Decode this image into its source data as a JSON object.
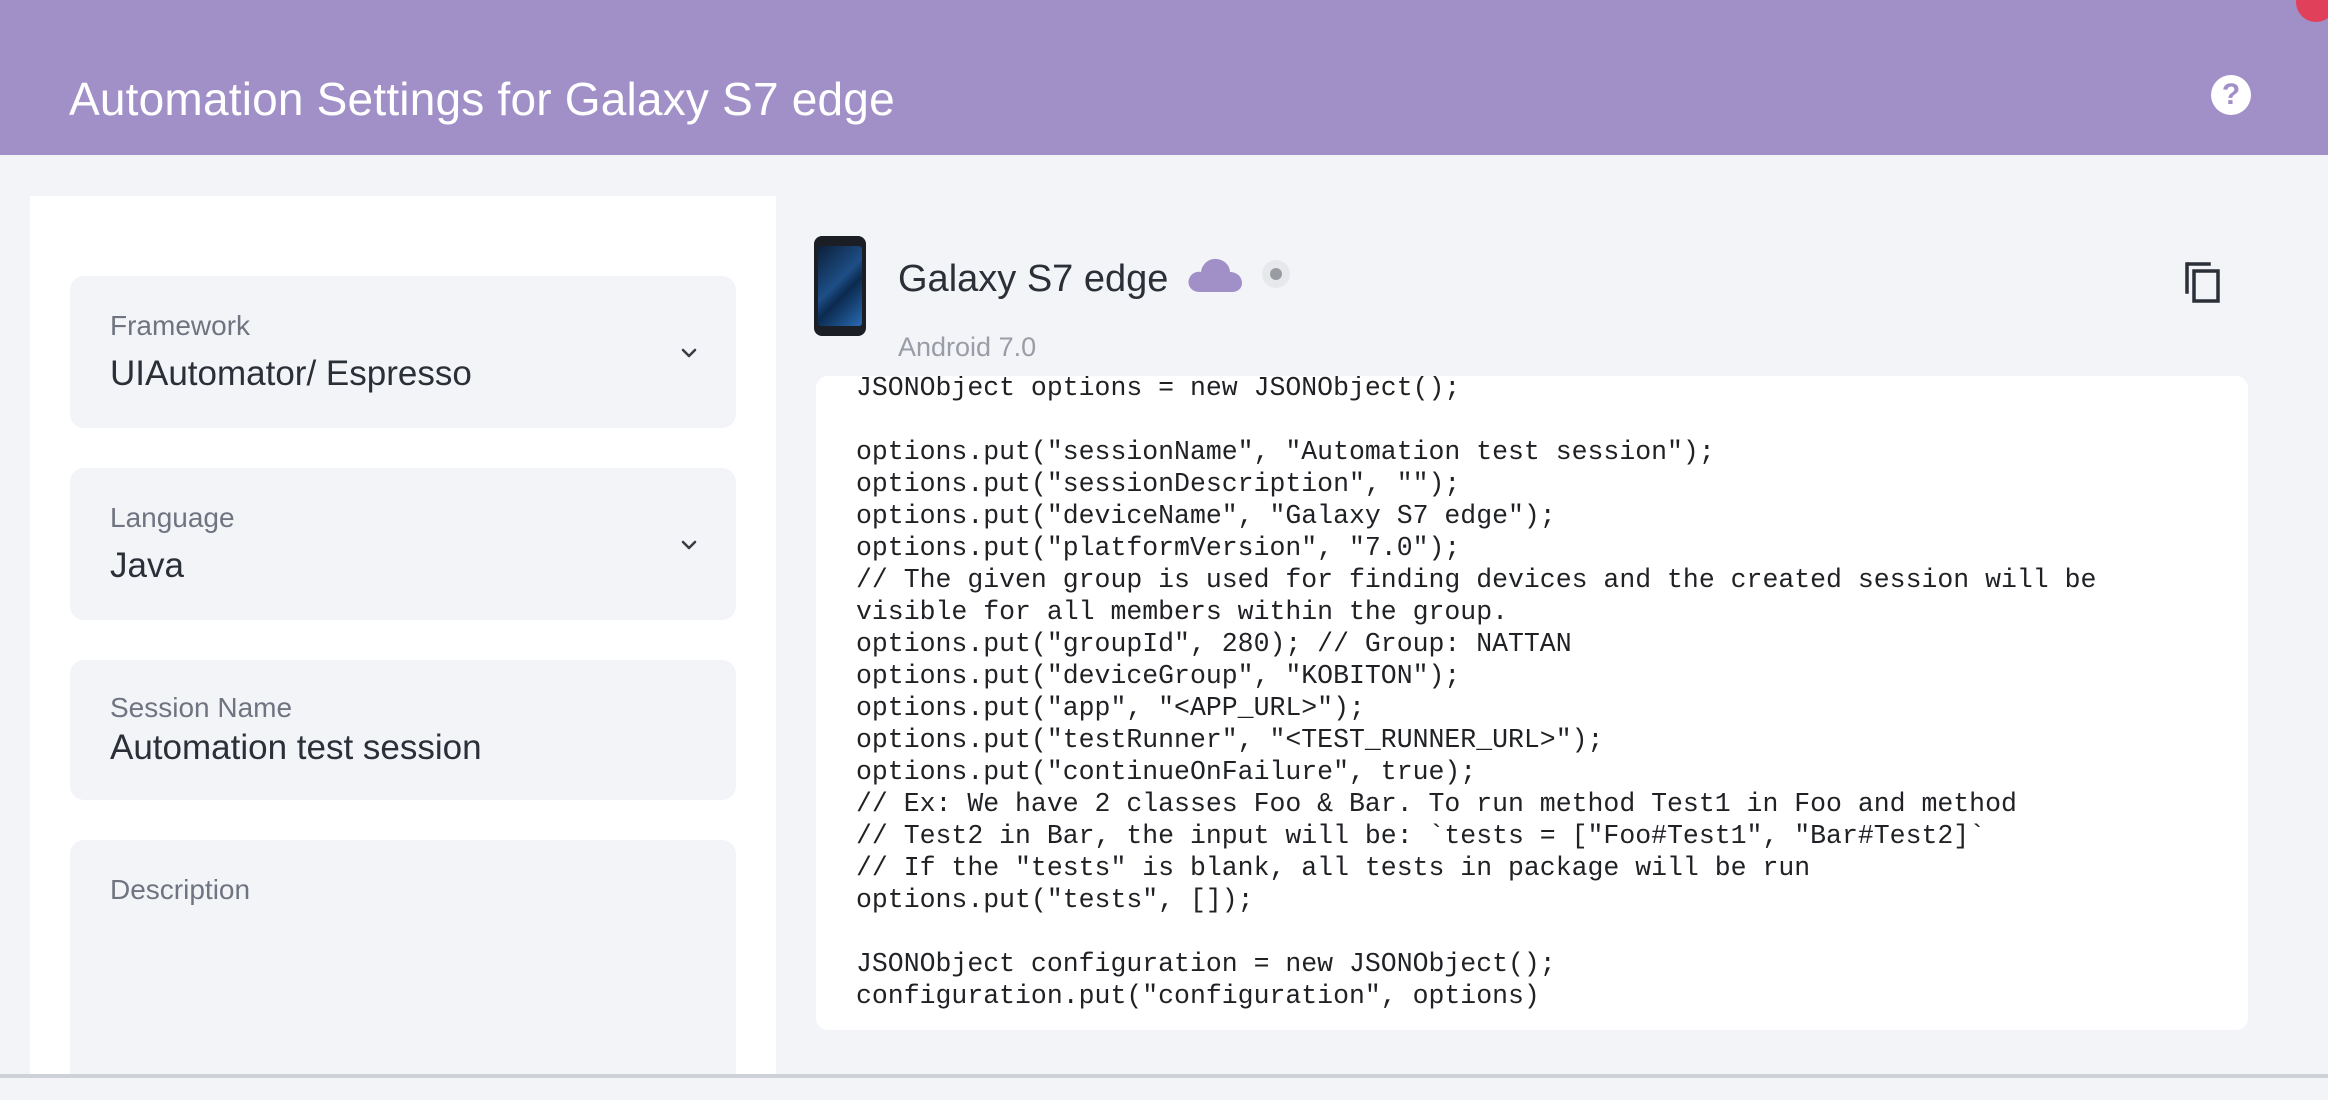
{
  "header": {
    "title": "Automation Settings for Galaxy S7 edge",
    "help_icon": "question-mark-icon",
    "color": "#a18fc8"
  },
  "form": {
    "framework": {
      "label": "Framework",
      "value": "UIAutomator/ Espresso"
    },
    "language": {
      "label": "Language",
      "value": "Java"
    },
    "session_name": {
      "label": "Session Name",
      "value": "Automation test session"
    },
    "description": {
      "label": "Description",
      "value": ""
    }
  },
  "device": {
    "name": "Galaxy S7 edge",
    "os": "Android 7.0",
    "cloud_icon": "cloud-icon",
    "cloud_color": "#a18fc8",
    "copy_icon": "copy-icon"
  },
  "code": {
    "lines": [
      "JSONObject options = new JSONObject();",
      "",
      "options.put(\"sessionName\", \"Automation test session\");",
      "options.put(\"sessionDescription\", \"\");",
      "options.put(\"deviceName\", \"Galaxy S7 edge\");",
      "options.put(\"platformVersion\", \"7.0\");",
      "// The given group is used for finding devices and the created session will be",
      "visible for all members within the group.",
      "options.put(\"groupId\", 280); // Group: NATTAN",
      "options.put(\"deviceGroup\", \"KOBITON\");",
      "options.put(\"app\", \"<APP_URL>\");",
      "options.put(\"testRunner\", \"<TEST_RUNNER_URL>\");",
      "options.put(\"continueOnFailure\", true);",
      "// Ex: We have 2 classes Foo & Bar. To run method Test1 in Foo and method",
      "// Test2 in Bar, the input will be: `tests = [\"Foo#Test1\", \"Bar#Test2]`",
      "// If the \"tests\" is blank, all tests in package will be run",
      "options.put(\"tests\", []);",
      "",
      "JSONObject configuration = new JSONObject();",
      "configuration.put(\"configuration\", options)"
    ]
  }
}
